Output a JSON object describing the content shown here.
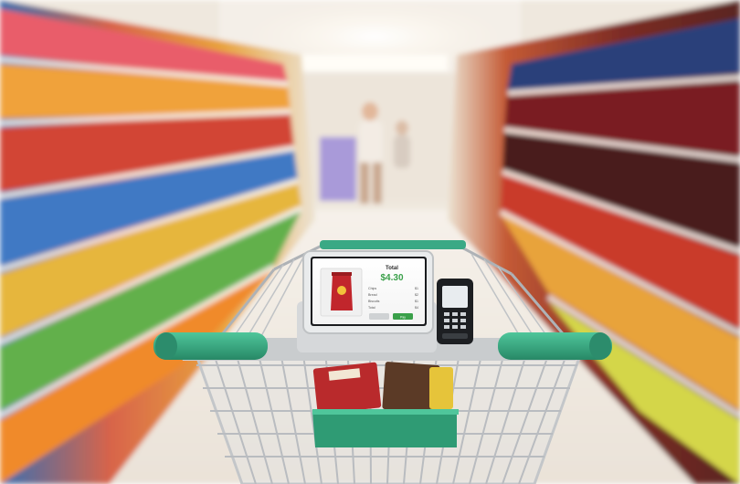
{
  "screen": {
    "title": "Total",
    "total": "$4.30",
    "items": [
      {
        "name": "Chips",
        "price": "$1"
      },
      {
        "name": "Bread",
        "price": "$2"
      },
      {
        "name": "Biscuits",
        "price": "$1"
      },
      {
        "name": "Total",
        "price": "$4"
      }
    ],
    "buttons": [
      "",
      "Pay"
    ]
  },
  "colors": {
    "cart_handle": "#3aa985",
    "accent_green": "#3aa04a",
    "aisle_floor": "#f1ece6",
    "ceiling_light": "#fffaf0"
  },
  "icons": [
    "shopping-cart",
    "card-terminal",
    "snack-bag"
  ]
}
